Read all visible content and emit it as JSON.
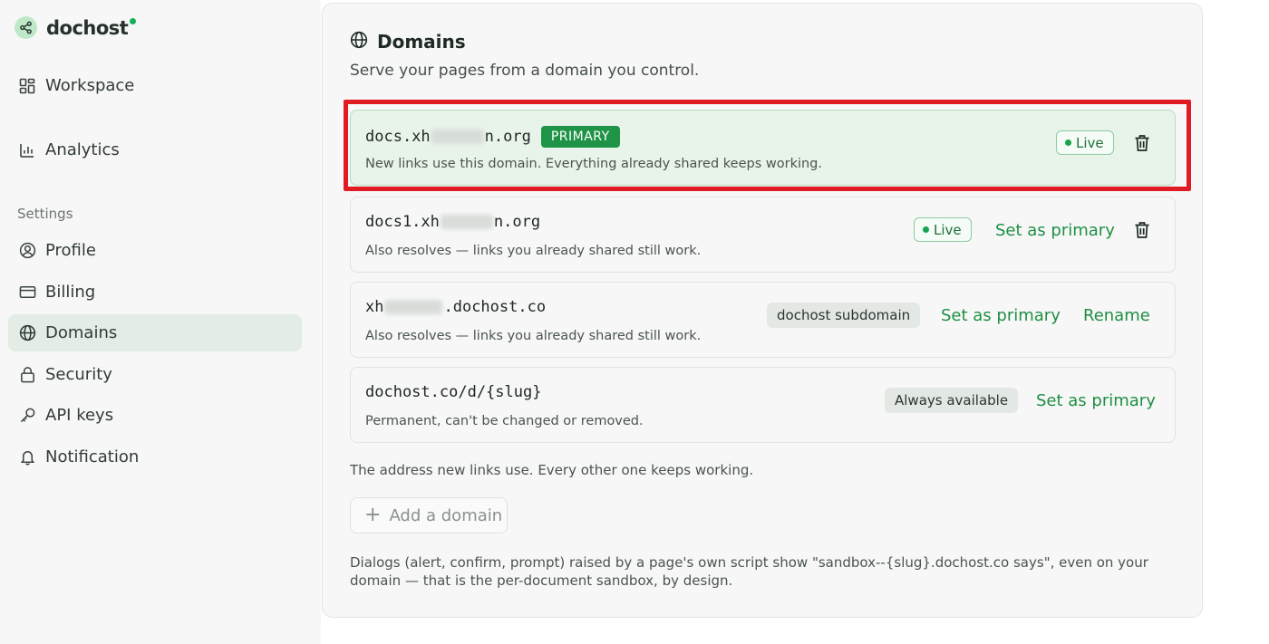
{
  "app": {
    "name": "dochost"
  },
  "sidebar": {
    "items": [
      {
        "label": "Workspace",
        "icon": "grid-icon"
      },
      {
        "label": "Analytics",
        "icon": "bar-chart-icon"
      }
    ],
    "section_label": "Settings",
    "settings_items": [
      {
        "label": "Profile",
        "icon": "user-circle-icon"
      },
      {
        "label": "Billing",
        "icon": "credit-card-icon"
      },
      {
        "label": "Domains",
        "icon": "globe-icon",
        "active": true
      },
      {
        "label": "Security",
        "icon": "lock-icon"
      },
      {
        "label": "API keys",
        "icon": "key-icon"
      },
      {
        "label": "Notification",
        "icon": "bell-icon"
      }
    ]
  },
  "domains": {
    "title": "Domains",
    "subtitle": "Serve your pages from a domain you control.",
    "rows": [
      {
        "host_prefix": "docs.xh",
        "host_suffix": "n.org",
        "badge": "PRIMARY",
        "description": "New links use this domain. Everything already shared keeps working.",
        "status": "Live"
      },
      {
        "host_prefix": "docs1.xh",
        "host_suffix": "n.org",
        "description": "Also resolves — links you already shared still work.",
        "status": "Live",
        "action": "Set as primary"
      },
      {
        "host_prefix": "xh",
        "host_suffix": ".dochost.co",
        "description": "Also resolves — links you already shared still work.",
        "chip": "dochost subdomain",
        "action": "Set as primary",
        "secondary_action": "Rename"
      },
      {
        "host": "dochost.co/d/{slug}",
        "description": "Permanent, can't be changed or removed.",
        "chip": "Always available",
        "action": "Set as primary"
      }
    ],
    "footer_note": "The address new links use. Every other one keeps working.",
    "add_button": "Add a domain",
    "dialog_note": "Dialogs (alert, confirm, prompt) raised by a page's own script show \"sandbox--{slug}.dochost.co says\", even on your domain — that is the per-document sandbox, by design."
  },
  "colors": {
    "accent": "#1f8f45",
    "primary_badge": "#1f9447",
    "highlight": "#e01b24",
    "sidebar_bg": "#f6f7f6"
  }
}
